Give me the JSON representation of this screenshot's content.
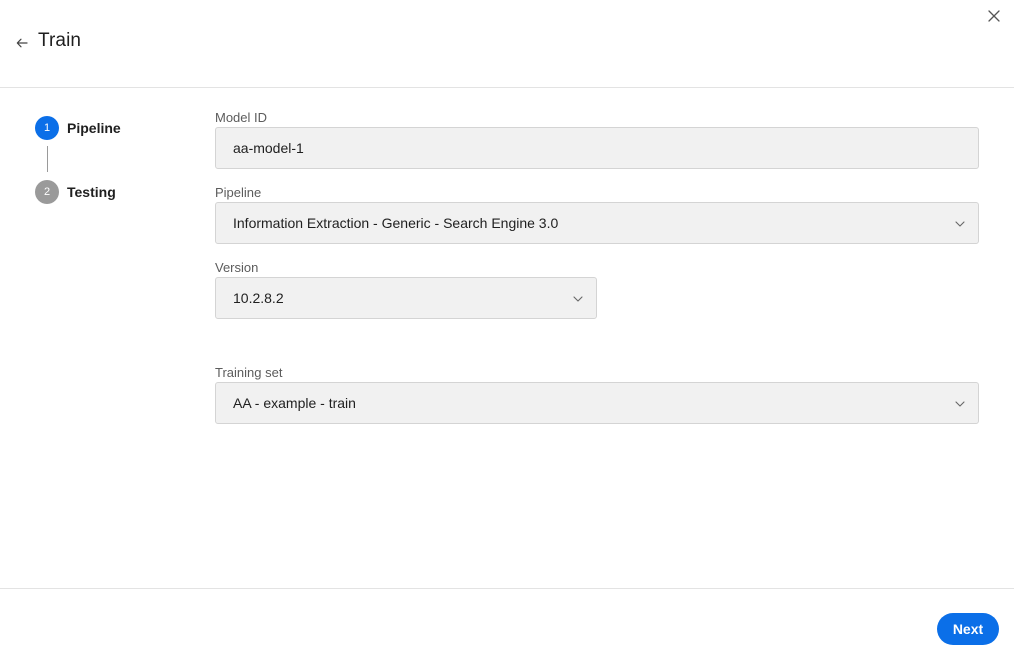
{
  "header": {
    "title": "Train",
    "back_icon": "arrow-left-icon",
    "close_icon": "close-icon"
  },
  "stepper": {
    "steps": [
      {
        "number": "1",
        "label": "Pipeline",
        "state": "active"
      },
      {
        "number": "2",
        "label": "Testing",
        "state": "inactive"
      }
    ]
  },
  "form": {
    "model_id": {
      "label": "Model ID",
      "value": "aa-model-1"
    },
    "pipeline": {
      "label": "Pipeline",
      "value": "Information Extraction - Generic - Search Engine 3.0",
      "icon": "chevron-down-icon"
    },
    "version": {
      "label": "Version",
      "value": "10.2.8.2",
      "icon": "chevron-down-icon"
    },
    "training_set": {
      "label": "Training set",
      "value": "AA - example - train",
      "icon": "chevron-down-icon"
    }
  },
  "footer": {
    "next_label": "Next"
  },
  "colors": {
    "accent": "#0b6fe8",
    "inactive_step": "#9a9a9a",
    "field_bg": "#f1f1f1"
  }
}
